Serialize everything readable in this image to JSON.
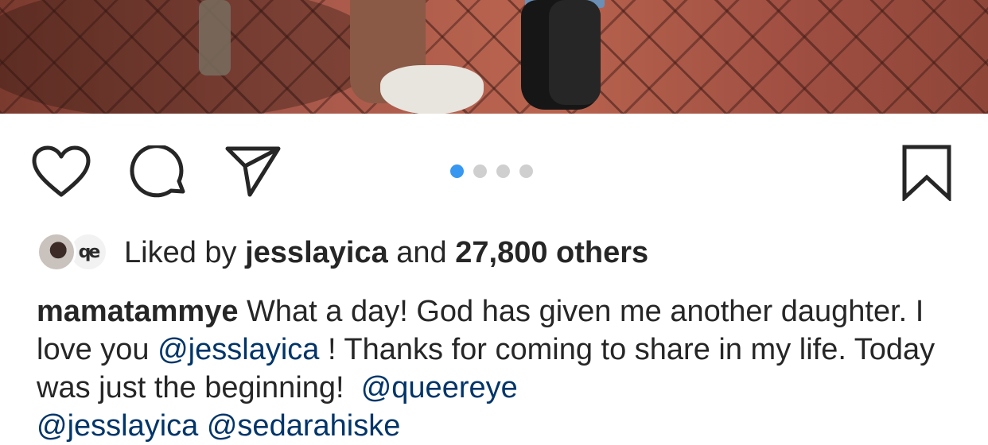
{
  "post": {
    "photo_alt": "brick pavement with two people's feet"
  },
  "actions": {
    "like_icon": "heart-outline-icon",
    "comment_icon": "comment-bubble-icon",
    "share_icon": "paper-plane-icon",
    "save_icon": "bookmark-outline-icon",
    "carousel": {
      "count": 4,
      "active_index": 0
    }
  },
  "likes": {
    "prefix": "Liked by",
    "user": "jesslayica",
    "conjunction": "and",
    "others": "27,800 others",
    "avatar2_text": "qe"
  },
  "caption": {
    "username": "mamatammye",
    "text_1": "What a day! God has given me another daughter. I love you",
    "mention_1": "@jesslayica",
    "text_2": "! Thanks for coming to share in my life. Today was just the beginning!",
    "mention_2": "@queereye",
    "partial_line": "@jesslayica @sedarahiske"
  },
  "colors": {
    "link": "#003569",
    "dot_active": "#3897f0",
    "dot_inactive": "#cfcfcf",
    "text": "#262626"
  }
}
